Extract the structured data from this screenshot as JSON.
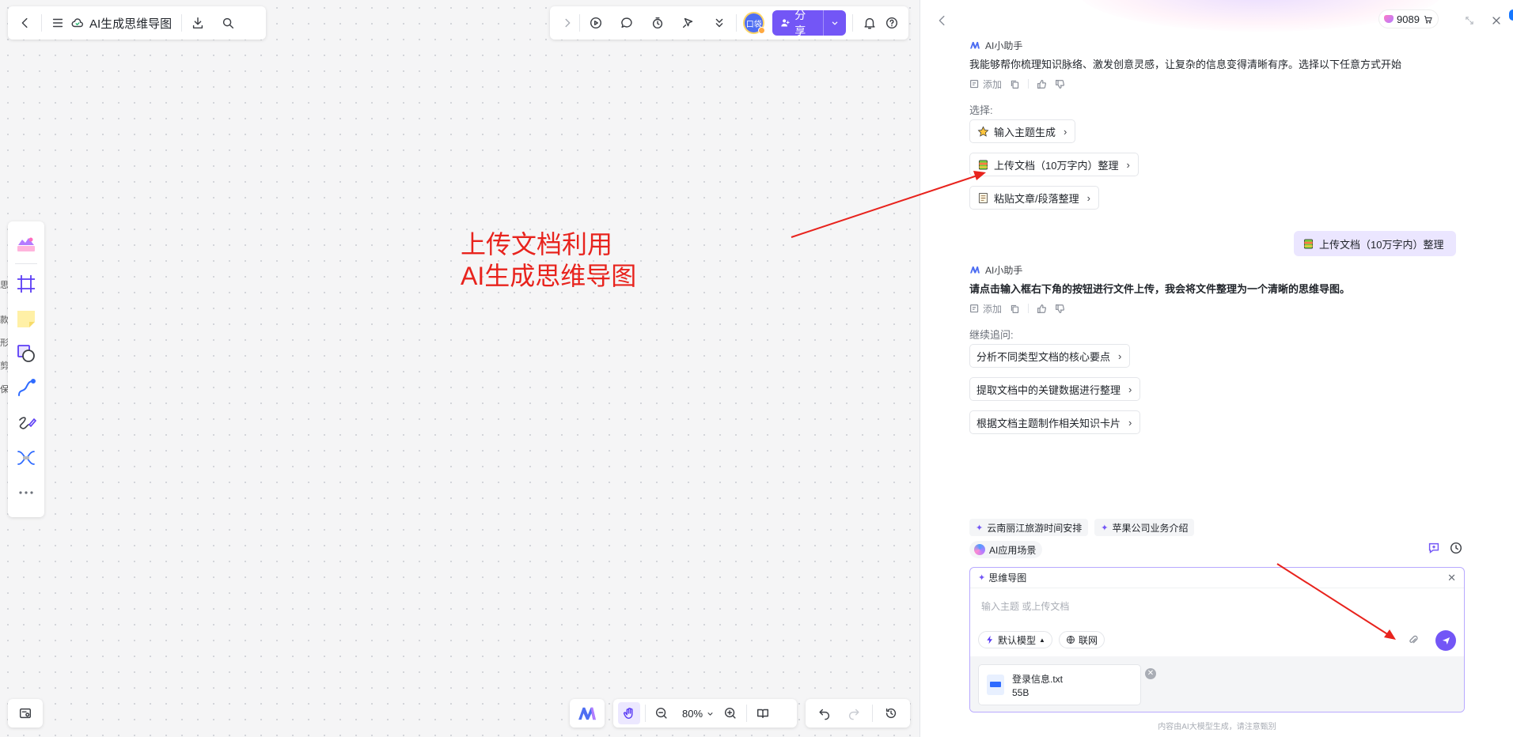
{
  "header": {
    "doc_title": "AI生成思维导图",
    "share_label": "分享",
    "avatar_text": "口袋"
  },
  "left_edge_fragments": [
    "思",
    "款",
    "形",
    "剪",
    "保"
  ],
  "zoom": {
    "value": "80%"
  },
  "annotation": {
    "line1": "上传文档利用",
    "line2": "AI生成思维导图",
    "color": "#e8231d"
  },
  "ai_panel": {
    "credits": "9089",
    "assistant_name": "AI小助手",
    "intro_message": "我能够帮你梳理知识脉络、激发创意灵感，让复杂的信息变得清晰有序。选择以下任意方式开始",
    "add_label": "添加",
    "choose_label": "选择:",
    "options": [
      {
        "icon": "star-icon",
        "label": "输入主题生成"
      },
      {
        "icon": "book-icon",
        "label": "上传文档（10万字内）整理"
      },
      {
        "icon": "memo-icon",
        "label": "粘贴文章/段落整理"
      }
    ],
    "user_message": "上传文档（10万字内）整理",
    "reply_message": "请点击输入框右下角的按钮进行文件上传，我会将文件整理为一个清晰的思维导图。",
    "followup_label": "继续追问:",
    "followups": [
      "分析不同类型文档的核心要点",
      "提取文档中的关键数据进行整理",
      "根据文档主题制作相关知识卡片"
    ],
    "suggestions": [
      "云南丽江旅游时间安排",
      "苹果公司业务介绍"
    ],
    "scene_label": "AI应用场景",
    "input": {
      "mode_tag": "思维导图",
      "placeholder": "输入主题 或上传文档",
      "model_label": "默认模型",
      "web_label": "联网",
      "file_name": "登录信息.txt",
      "file_size": "55B"
    },
    "footer": "内容由AI大模型生成，请注意甄别"
  },
  "colors": {
    "accent": "#7356f6",
    "user_bubble": "#ebe6ff",
    "annotation": "#e8231d"
  }
}
